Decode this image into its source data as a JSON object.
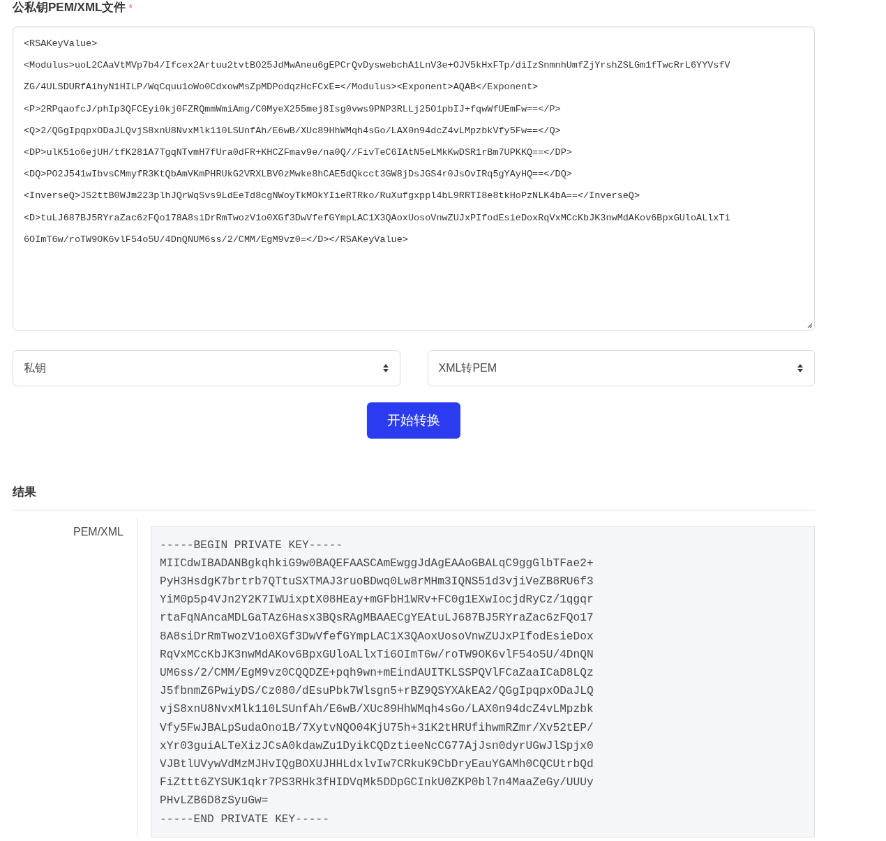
{
  "field": {
    "label": "公私钥PEM/XML文件",
    "required_mark": "*",
    "lines": [
      "<RSAKeyValue>",
      "<Modulus>uoL2CAaVtMVp7b4/Ifcex2Artuu2tvtBO25JdMwAneu6gEPCrQvDyswebchA1LnV3e+OJV5kHxFTp/diIzSnmnhUmfZjYrshZSLGm1fTwcRrL6YYVsfV",
      "ZG/4ULSDURfAihyN1HILP/WqCquu1oWo0CdxowMsZpMDPodqzHcFCxE=</Modulus><Exponent>AQAB</Exponent>",
      "<P>2RPqaofcJ/phIp3QFCEyi0kj0FZRQmmWmiAmg/C0MyeX255mej8Isg0vws9PNP3RLLj25O1pbIJ+fqwWfUEmFw==</P>",
      "<Q>2/QGgIpqpxODaJLQvjS8xnU8NvxMlk110LSUnfAh/E6wB/XUc89HhWMqh4sGo/LAX0n94dcZ4vLMpzbkVfy5Fw==</Q>",
      "<DP>ulK51o6ejUH/tfK281A7TgqNTvmH7fUra0dFR+KHCZFmav9e/na0Q//FivTeC6IAtN5eLMkKwDSR1rBm7UPKKQ==</DP>",
      "<DQ>PO2J541wIbvsCMmyfR3KtQbAmVKmPHRUkG2VRXLBV0zMwke8hCAE5dQkcct3GW8jDsJGS4r0JsOvIRq5gYAyHQ==</DQ>",
      "<InverseQ>JS2ttB0WJm223plhJQrWqSvs9LdEeTd8cgNWoyTkMOkYIieRTRko/RuXufgxppl4bL9RRTI8e8tkHoPzNLK4bA==</InverseQ>",
      "<D>tuLJ687BJ5RYraZac6zFQo178A8siDrRmTwozV1o0XGf3DwVfefGYmpLAC1X3QAoxUosoVnwZUJxPIfodEsieDoxRqVxMCcKbJK3nwMdAKov6BpxGUloALlxTi",
      "6OImT6w/roTW9OK6vlF54o5U/4DnQNUM6ss/2/CMM/EgM9vz0=</D></RSAKeyValue>"
    ]
  },
  "selects": [
    {
      "value": "私钥"
    },
    {
      "value": "XML转PEM"
    }
  ],
  "convert_button": "开始转换",
  "result": {
    "heading": "结果",
    "label": "PEM/XML",
    "lines": [
      "-----BEGIN PRIVATE KEY-----",
      "MIICdwIBADANBgkqhkiG9w0BAQEFAASCAmEwggJdAgEAAoGBALqC9ggGlbTFae2+",
      "PyH3HsdgK7brtrb7QTtuSXTMAJ3ruoBDwq0Lw8rMHm3IQNS51d3vjiVeZB8RU6f3",
      "YiM0p5p4VJn2Y2K7IWUixptX08HEay+mGFbH1WRv+FC0g1EXwIocjdRyCz/1qgqr",
      "rtaFqNAncaMDLGaTAz6Hasx3BQsRAgMBAAECgYEAtuLJ687BJ5RYraZac6zFQo17",
      "8A8siDrRmTwozV1o0XGf3DwVfefGYmpLAC1X3QAoxUosoVnwZUJxPIfodEsieDox",
      "RqVxMCcKbJK3nwMdAKov6BpxGUloALlxTi6OImT6w/roTW9OK6vlF54o5U/4DnQN",
      "UM6ss/2/CMM/EgM9vz0CQQDZE+pqh9wn+mEindAUITKLSSPQVlFCaZaaICaD8LQz",
      "J5fbnmZ6PwiyDS/Cz080/dEsuPbk7Wlsgn5+rBZ9QSYXAkEA2/QGgIpqpxODaJLQ",
      "vjS8xnU8NvxMlk110LSUnfAh/E6wB/XUc89HhWMqh4sGo/LAX0n94dcZ4vLMpzbk",
      "Vfy5FwJBALpSudaOno1B/7XytvNQO04KjU75h+31K2tHRUfihwmRZmr/Xv52tEP/",
      "xYr03guiALTeXizJCsA0kdawZu1DyikCQDztieeNcCG77AjJsn0dyrUGwJlSpjx0",
      "VJBtlUVywVdMzMJHvIQgBOXUJHHLdxlvIw7CRkuK9CbDryEauYGAMh0CQCUtrbQd",
      "FiZttt6ZYSUK1qkr7PS3RHk3fHIDVqMk5DDpGCInkU0ZKP0bl7n4MaaZeGy/UUUy",
      "PHvLZB6D8zSyuGw=",
      "-----END PRIVATE KEY-----"
    ]
  }
}
